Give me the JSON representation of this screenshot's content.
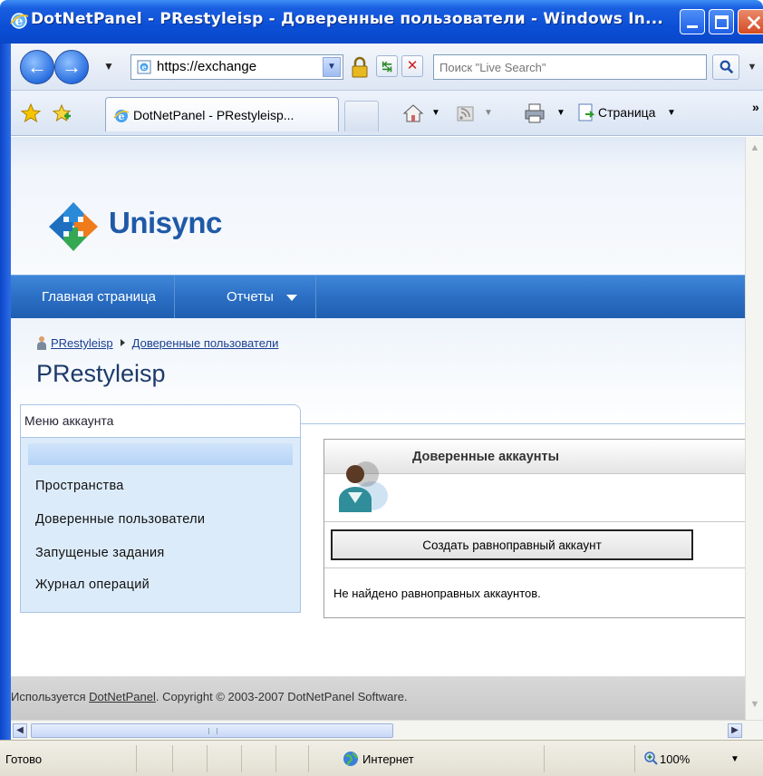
{
  "window": {
    "title": "DotNetPanel - PRestyleisp - Доверенные пользователи - Windows In..."
  },
  "address_bar": {
    "url": "https://exchange",
    "search_placeholder": "Поиск \"Live Search\""
  },
  "tabs": [
    {
      "label": "DotNetPanel - PRestyleisp..."
    }
  ],
  "command_bar": {
    "page_label": "Страница",
    "more": "»"
  },
  "brand": {
    "name": "Unisync",
    "color": "#1f5aa8"
  },
  "menu": {
    "home": "Главная страница",
    "reports": "Отчеты"
  },
  "breadcrumb": {
    "items": [
      "PRestyleisp",
      "Доверенные пользователи"
    ]
  },
  "page": {
    "title": "PRestyleisp"
  },
  "account_menu": {
    "header": "Меню аккаунта",
    "items": [
      "Пространства",
      "Доверенные пользователи",
      "Запущеные задания",
      "Журнал операций"
    ]
  },
  "panel": {
    "title": "Доверенные аккаунты",
    "create_button": "Создать равноправный аккаунт",
    "empty_message": "Не найдено равноправных аккаунтов."
  },
  "footer": {
    "prefix": "Используется",
    "link": "DotNetPanel",
    "suffix": ". Copyright © 2003-2007 DotNetPanel Software."
  },
  "status_bar": {
    "status": "Готово",
    "zone": "Интернет",
    "zoom": "100%"
  },
  "colors": {
    "menubar": "#2b6fc4",
    "titlebar": "#0b4fd6",
    "menu_panel": "#dcebfa"
  }
}
